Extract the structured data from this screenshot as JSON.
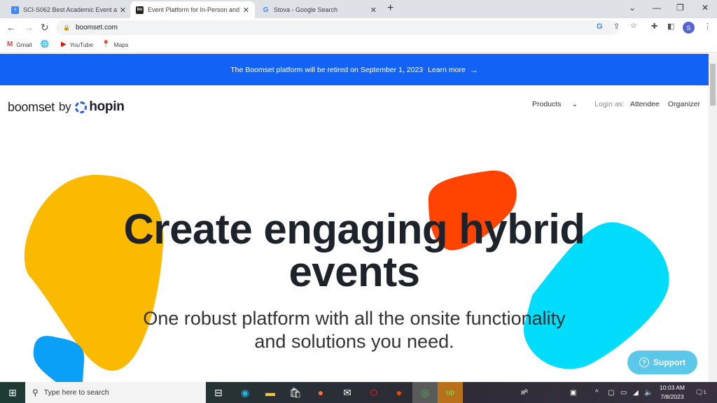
{
  "browser": {
    "tabs": [
      {
        "title": "SCI-S062 Best Academic Event a",
        "favicon": "docs-icon",
        "active": false
      },
      {
        "title": "Event Platform for In-Person and",
        "favicon": "boomset-icon",
        "active": true
      },
      {
        "title": "Stova - Google Search",
        "favicon": "google-icon",
        "active": false
      }
    ],
    "url": "boomset.com",
    "profile_initial": "S",
    "bookmarks": [
      {
        "label": "Gmail",
        "icon": "gmail-icon"
      },
      {
        "label": "",
        "icon": "globe-icon"
      },
      {
        "label": "YouTube",
        "icon": "youtube-icon"
      },
      {
        "label": "Maps",
        "icon": "maps-icon"
      }
    ]
  },
  "banner": {
    "text": "The Boomset platform will be retired on September 1, 2023",
    "link": "Learn more",
    "color": "#1362f6"
  },
  "site": {
    "logo_left": "boomset",
    "logo_by": "by",
    "logo_right": "hopin",
    "nav": {
      "products": "Products",
      "login_as": "Login as:",
      "attendee": "Attendee",
      "organizer": "Organizer"
    },
    "hero_line1": "Create engaging hybrid",
    "hero_line2": "events",
    "sub_line1": "One robust platform with all the onsite functionality",
    "sub_line2": "and solutions you need.",
    "support": "Support",
    "blob_colors": {
      "yellow": "#fbba00",
      "orange": "#ff4300",
      "cyan": "#00dcfb",
      "blue": "#0aa0f8"
    }
  },
  "taskbar": {
    "search_placeholder": "Type here to search",
    "time": "10:03 AM",
    "date": "7/8/2023",
    "notification_count": "1"
  }
}
